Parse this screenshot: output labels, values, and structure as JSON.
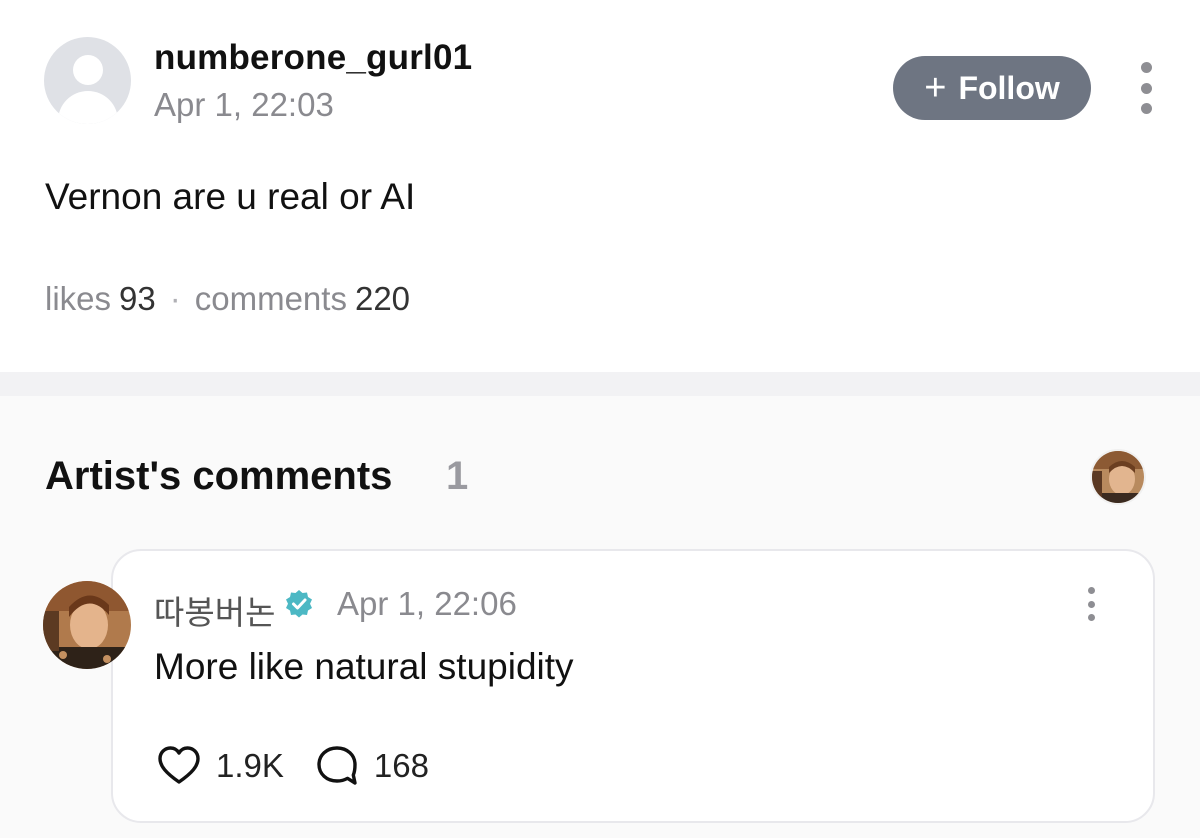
{
  "post": {
    "username": "numberone_gurl01",
    "time": "Apr 1, 22:03",
    "follow_label": "Follow",
    "text": "Vernon are u real or AI",
    "likes_label": "likes",
    "likes_count": "93",
    "separator": "·",
    "comments_label": "comments",
    "comments_count": "220"
  },
  "artist_comments": {
    "title": "Artist's comments",
    "count": "1",
    "comment": {
      "author": "따봉버논",
      "verified": true,
      "time": "Apr 1, 22:06",
      "text": "More like natural stupidity",
      "like_count": "1.9K",
      "reply_count": "168"
    }
  },
  "icons": [
    "default-avatar-icon",
    "plus-icon",
    "more-options-icon",
    "verified-badge-icon",
    "heart-icon",
    "comment-bubble-icon"
  ],
  "colors": {
    "follow_button": "#6e7582",
    "verified_badge": "#4cb8c4",
    "muted_text": "#8a8a8f",
    "section_background": "#fafafa"
  }
}
